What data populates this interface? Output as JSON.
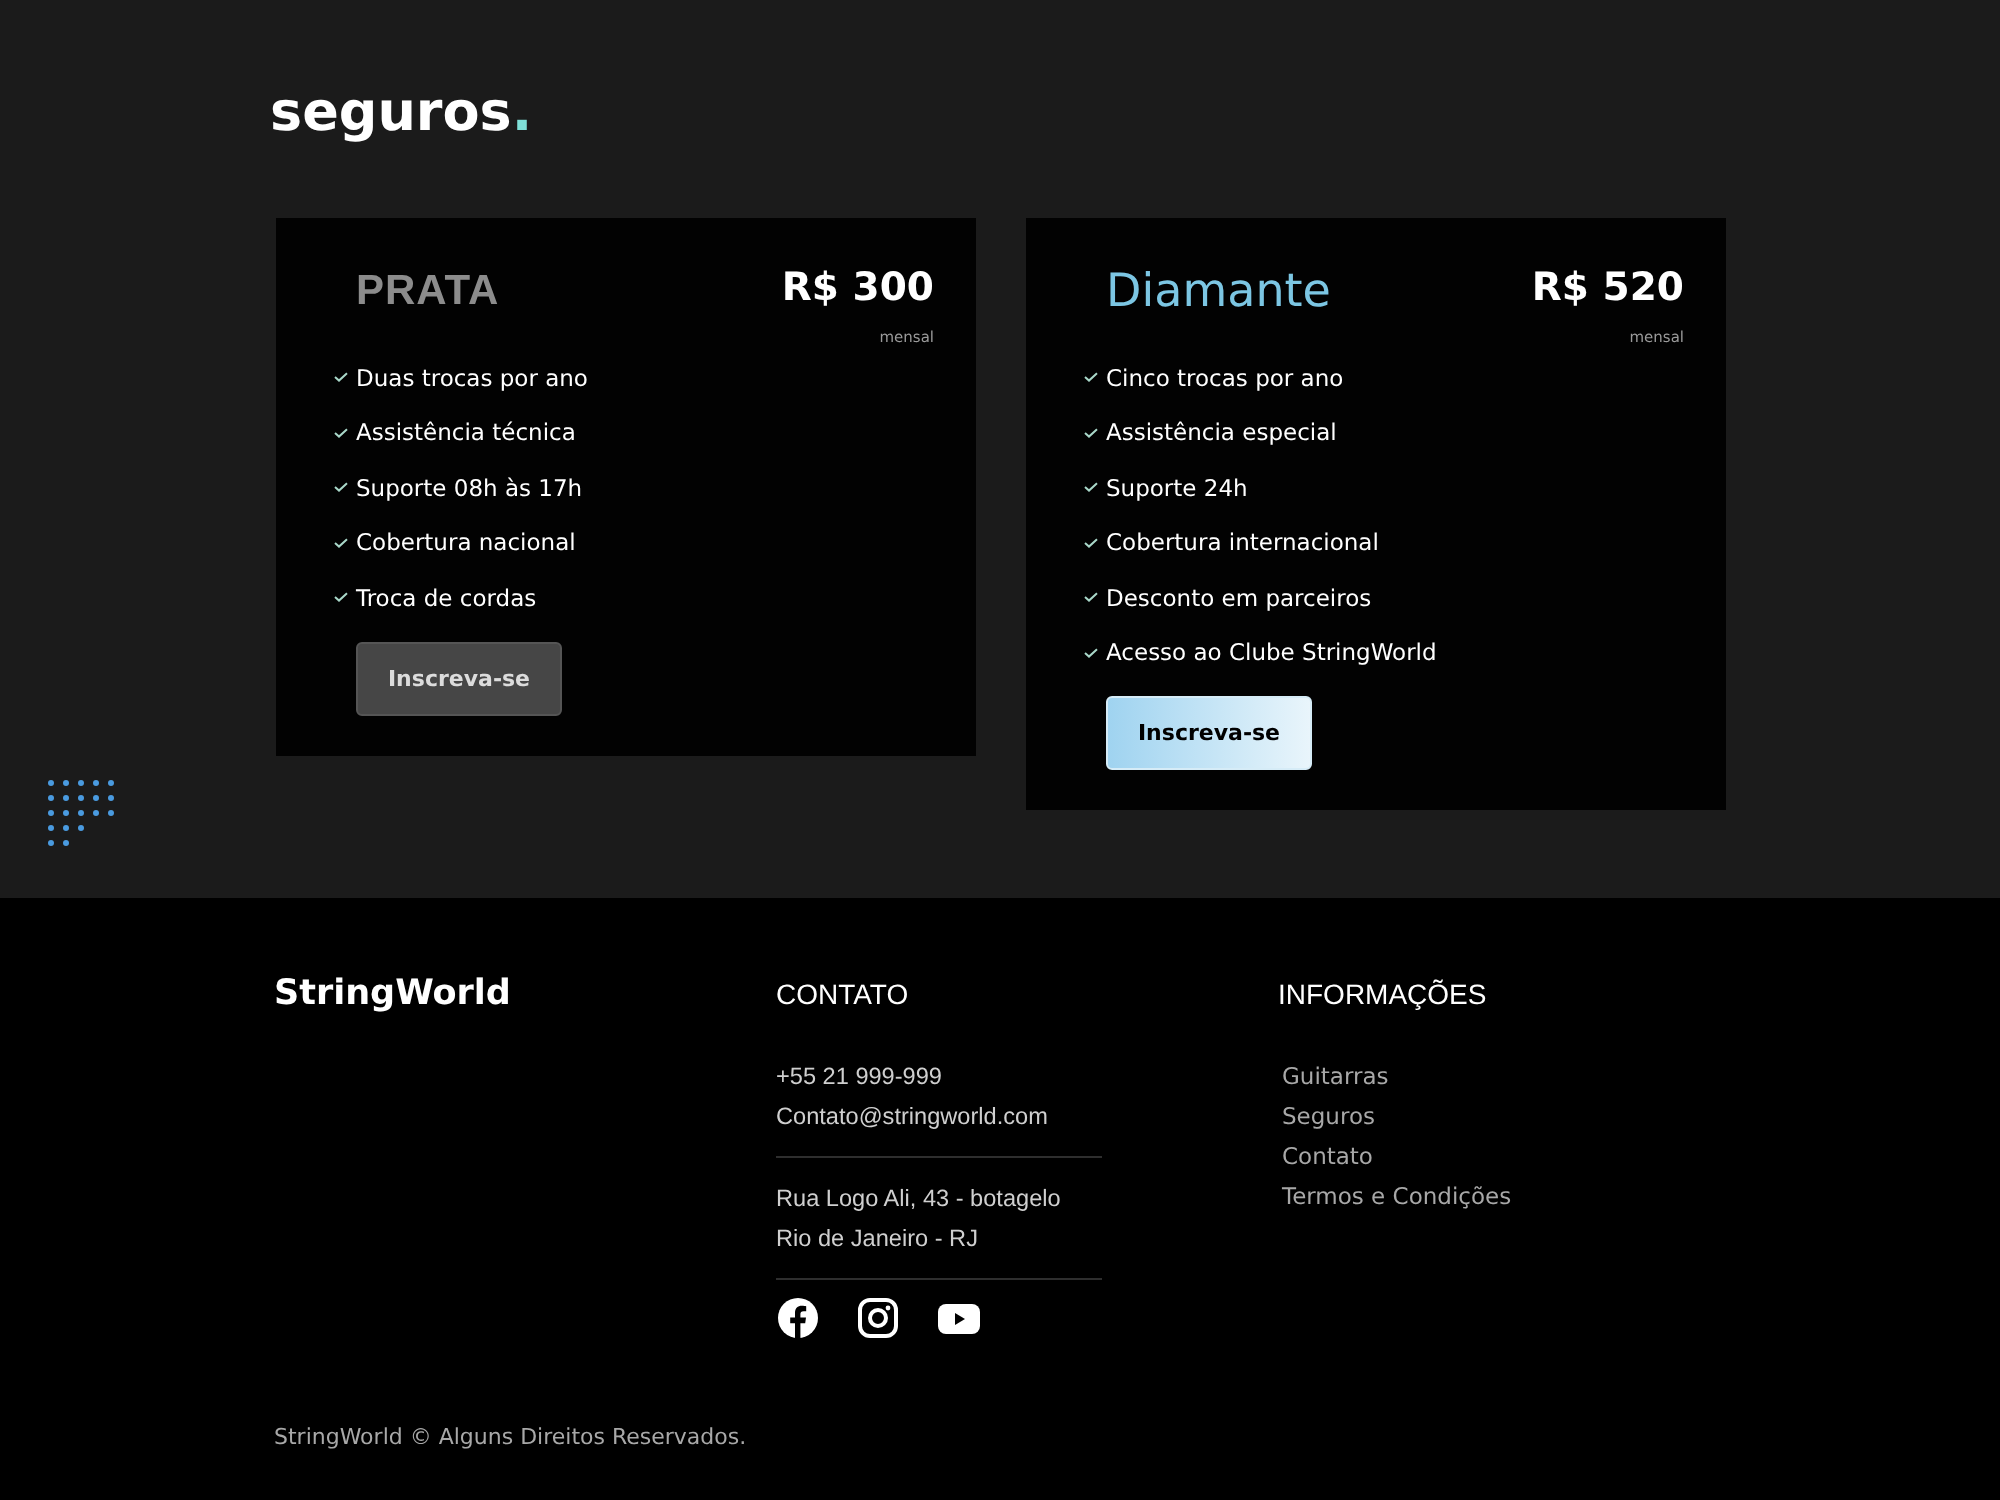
{
  "header": {
    "title": "seguros",
    "title_accent": "."
  },
  "plans": [
    {
      "name": "PRATA",
      "featured": false,
      "price": "R$ 300",
      "period": "mensal",
      "features": [
        "Duas trocas por ano",
        "Assistência técnica",
        "Suporte 08h às 17h",
        "Cobertura nacional",
        "Troca de cordas"
      ],
      "button": "Inscreva-se"
    },
    {
      "name": "Diamante",
      "featured": true,
      "price": "R$ 520",
      "period": "mensal",
      "features": [
        "Cinco trocas por ano",
        "Assistência especial",
        "Suporte 24h",
        "Cobertura internacional",
        "Desconto em parceiros",
        "Acesso ao Clube StringWorld"
      ],
      "button": "Inscreva-se"
    }
  ],
  "footer": {
    "brand": "StringWorld",
    "contact": {
      "heading": "CONTATO",
      "groups": [
        {
          "lines": [
            "+55 21 999-999",
            "Contato@stringworld.com"
          ]
        },
        {
          "lines": [
            "Rua Logo Ali, 43 - botagelo",
            "Rio de Janeiro - RJ"
          ]
        }
      ]
    },
    "info": {
      "heading": "INFORMAÇÕES",
      "links": [
        "Guitarras",
        "Seguros",
        "Contato",
        "Termos e Condições"
      ]
    },
    "copyright": "StringWorld © Alguns Direitos Reservados."
  }
}
